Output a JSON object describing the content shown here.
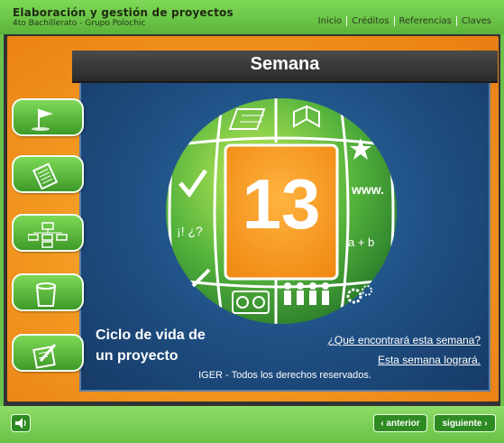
{
  "header": {
    "title": "Elaboración y gestión de proyectos",
    "subtitle": "4to Bachillerato - Grupo Polochic",
    "nav": [
      "Inicio",
      "Créditos",
      "Referencias",
      "Claves"
    ]
  },
  "main": {
    "heading": "Semana",
    "week_number": "13",
    "topic_line1": "Ciclo de vida de",
    "topic_line2": "un proyecto",
    "link_what": "¿Qué encontrará esta semana?",
    "link_achieve": "Esta semana logrará.",
    "copyright": "IGER - Todos los derechos reservados."
  },
  "sidebar": {
    "items": [
      {
        "icon": "flag-icon"
      },
      {
        "icon": "document-icon"
      },
      {
        "icon": "org-chart-icon"
      },
      {
        "icon": "trash-icon"
      },
      {
        "icon": "edit-icon"
      }
    ]
  },
  "globe_tiles": {
    "www": "www.",
    "math": "a + b",
    "question": "¡! ¿?"
  },
  "footer": {
    "prev_label": "‹ anterior",
    "next_label": "siguiente ›",
    "sound_icon": "speaker-icon"
  },
  "colors": {
    "green": "#6cc04a",
    "orange": "#f39a22",
    "blue": "#1e4e82",
    "dark": "#333333"
  }
}
